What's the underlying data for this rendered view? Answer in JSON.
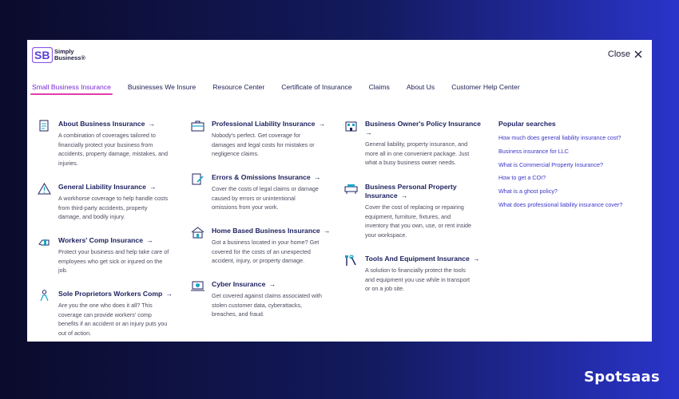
{
  "logo": {
    "mark": "SB",
    "line1": "Simply",
    "line2": "Business",
    "reg": "®"
  },
  "close_label": "Close",
  "nav": [
    {
      "label": "Small Business Insurance",
      "active": true
    },
    {
      "label": "Businesses We Insure"
    },
    {
      "label": "Resource Center"
    },
    {
      "label": "Certificate of Insurance"
    },
    {
      "label": "Claims"
    },
    {
      "label": "About Us"
    },
    {
      "label": "Customer Help Center"
    }
  ],
  "columns": [
    [
      {
        "icon": "document-icon",
        "title": "About Business Insurance",
        "arrow": "→",
        "desc": [
          "A combination of coverages tailored to",
          "financially protect your business from",
          "accidents, property damage, mistakes, and",
          "injuries."
        ]
      },
      {
        "icon": "warning-triangle-icon",
        "title": "General Liability Insurance",
        "arrow": "→",
        "desc": [
          "A workhorse coverage to help handle costs",
          "from third-party accidents, property",
          "damage, and bodily injury."
        ]
      },
      {
        "icon": "bandaged-hand-icon",
        "title": "Workers' Comp Insurance",
        "arrow": "→",
        "desc": [
          "Protect your business and help take care of",
          "employees who get sick or injured on the",
          "job."
        ]
      },
      {
        "icon": "person-icon",
        "title": "Sole Proprietors Workers Comp",
        "arrow": "→",
        "desc": [
          "Are you the one who does it all? This",
          "coverage can provide workers' comp",
          "benefits if an accident or an injury puts you",
          "out of action."
        ]
      }
    ],
    [
      {
        "icon": "briefcase-icon",
        "title": "Professional Liability Insurance",
        "arrow": "→",
        "desc": [
          "Nobody's perfect. Get coverage for",
          "damages and legal costs for mistakes or",
          "negligence claims."
        ]
      },
      {
        "icon": "pencil-document-icon",
        "title": "Errors & Omissions Insurance",
        "arrow": "→",
        "desc": [
          "Cover the costs of legal claims or damage",
          "caused by errors or unintentional",
          "omissions from your work."
        ]
      },
      {
        "icon": "home-icon",
        "title": "Home Based Business Insurance",
        "arrow": "→",
        "desc": [
          "Got a business located in your home? Get",
          "covered for the costs of an unexpected",
          "accident, injury, or property damage."
        ]
      },
      {
        "icon": "laptop-shield-icon",
        "title": "Cyber Insurance",
        "arrow": "→",
        "desc": [
          "Get covered against claims associated with",
          "stolen customer data, cyberattacks,",
          "breaches, and fraud."
        ]
      }
    ],
    [
      {
        "icon": "building-icon",
        "title": "Business Owner's Policy Insurance",
        "arrow": "→",
        "desc": [
          "General liability, property insurance, and",
          "more all in one convenient package. Just",
          "what a busy business owner needs."
        ]
      },
      {
        "icon": "furniture-icon",
        "title": "Business Personal Property",
        "title2": "Insurance",
        "arrow": "→",
        "desc": [
          "Cover the cost of replacing or repairing",
          "equipment, furniture, fixtures, and",
          "inventory that you own, use, or rent inside",
          "your workspace."
        ]
      },
      {
        "icon": "tools-icon",
        "title": "Tools And Equipment Insurance",
        "arrow": "→",
        "desc": [
          "A solution to financially protect the tools",
          "and equipment you use while in transport",
          "or on a job site."
        ]
      }
    ]
  ],
  "popular": {
    "heading": "Popular searches",
    "links": [
      "How much does general liability insurance cost?",
      "Business insurance for LLC",
      "What is Commercial Property Insurance?",
      "How to get a COI?",
      "What is a ghost policy?",
      "What does professional liability insurance cover?"
    ]
  },
  "brand": "Spotsaas",
  "colors": {
    "accent": "#3b35c9",
    "underline": "#e03fa8",
    "icon": "#1aa7c7",
    "title": "#1f2360"
  }
}
